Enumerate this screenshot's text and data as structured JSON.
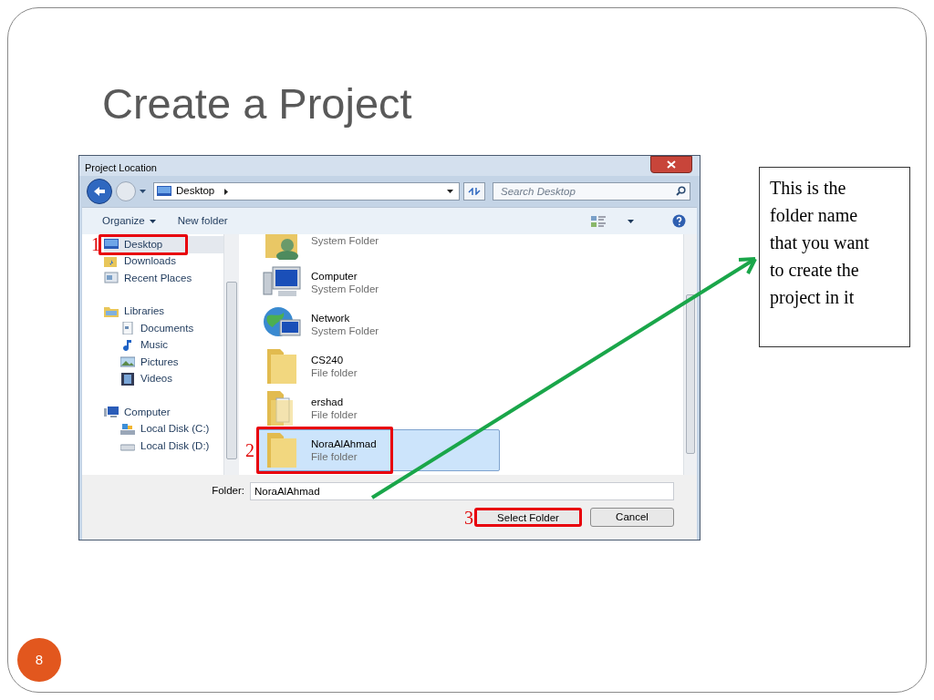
{
  "slide": {
    "title": "Create a Project",
    "page_number": "8",
    "callout": "This is the folder name that you want to create the project in it"
  },
  "dialog": {
    "title": "Project Location",
    "address": "Desktop",
    "search": {
      "placeholder": "Search Desktop"
    },
    "toolbar": [
      {
        "label": "Organize",
        "menu": true
      },
      {
        "label": "New folder",
        "menu": false
      }
    ],
    "nav": [
      {
        "children": [
          {
            "label": "Desktop",
            "kind": "desktop",
            "selected": true,
            "step": "1"
          },
          {
            "label": "Downloads",
            "kind": "downloads",
            "selected": false
          },
          {
            "label": "Recent Places",
            "kind": "recent",
            "selected": false
          }
        ]
      },
      {
        "label": "Libraries",
        "kind": "libraries",
        "selected": false,
        "children": [
          {
            "label": "Documents",
            "kind": "documents",
            "selected": false
          },
          {
            "label": "Music",
            "kind": "music",
            "selected": false
          },
          {
            "label": "Pictures",
            "kind": "pictures",
            "selected": false
          },
          {
            "label": "Videos",
            "kind": "videos",
            "selected": false
          }
        ]
      },
      {
        "label": "Computer",
        "kind": "computer",
        "selected": false,
        "children": [
          {
            "label": "Local Disk (C:)",
            "kind": "disk",
            "selected": false
          },
          {
            "label": "Local Disk (D:)",
            "kind": "drive",
            "selected": false
          }
        ]
      }
    ],
    "files": [
      {
        "kind": "user",
        "type": "System Folder",
        "selected": false
      },
      {
        "kind": "computer",
        "name": "Computer",
        "type": "System Folder",
        "selected": false
      },
      {
        "kind": "network",
        "name": "Network",
        "type": "System Folder",
        "selected": false
      },
      {
        "kind": "folder",
        "name": "CS240",
        "type": "File folder",
        "selected": false
      },
      {
        "kind": "docs",
        "name": "ershad",
        "type": "File folder",
        "selected": false
      },
      {
        "kind": "folder",
        "name": "NoraAlAhmad",
        "type": "File folder",
        "selected": true,
        "step": "2"
      }
    ],
    "folder": {
      "label": "Folder:",
      "value": "NoraAlAhmad"
    },
    "buttons": [
      {
        "label": "Select Folder",
        "step": "3"
      },
      {
        "label": "Cancel"
      }
    ]
  }
}
